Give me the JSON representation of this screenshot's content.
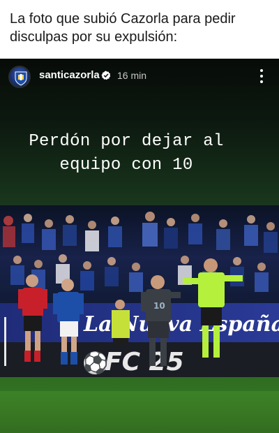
{
  "post": {
    "caption": "La foto que subió Cazorla para pedir disculpas por su expulsión:"
  },
  "story": {
    "username": "santicazorla",
    "time_ago": "16 min",
    "overlay_line1": "Perdón por dejar al",
    "overlay_line2": "equipo con 10"
  },
  "photo": {
    "ad_board_text": "La Nueva España",
    "ad_board_brand": "FC 25",
    "shirt_number": "10",
    "colors": {
      "story_top": "#070b08",
      "story_green": "#1c3b1f",
      "pitch": "#3a7a24",
      "home_kit": "#1e4fa8",
      "away_kit": "#c8202a",
      "referee": "#b4f03c",
      "keeper": "#3a3f45"
    }
  }
}
